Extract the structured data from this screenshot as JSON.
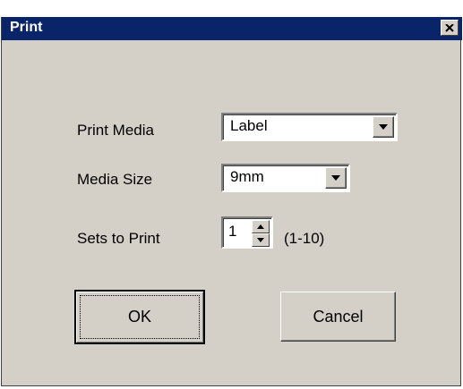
{
  "window": {
    "title": "Print"
  },
  "titlebar": {
    "close_icon": "close-icon"
  },
  "form": {
    "print_media": {
      "label": "Print Media",
      "value": "Label"
    },
    "media_size": {
      "label": "Media Size",
      "value": "9mm"
    },
    "sets_to_print": {
      "label": "Sets to Print",
      "value": "1",
      "range_hint": "(1-10)"
    }
  },
  "buttons": {
    "ok": "OK",
    "cancel": "Cancel"
  },
  "colors": {
    "titlebar": "#0a246a",
    "face": "#d4d0c8"
  }
}
